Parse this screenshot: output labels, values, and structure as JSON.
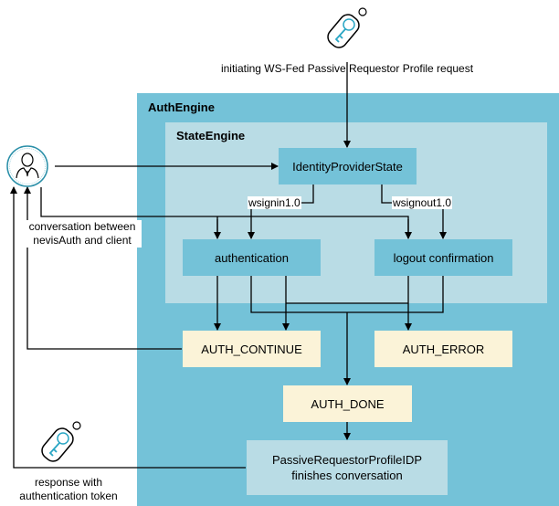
{
  "diagram": {
    "containers": {
      "auth_engine": "AuthEngine",
      "state_engine": "StateEngine"
    },
    "nodes": {
      "identity_provider_state": "IdentityProviderState",
      "authentication": "authentication",
      "logout_confirmation": "logout confirmation",
      "auth_continue": "AUTH_CONTINUE",
      "auth_error": "AUTH_ERROR",
      "auth_done": "AUTH_DONE",
      "passive_idp_line1": "PassiveRequestorProfileIDP",
      "passive_idp_line2": "finishes conversation"
    },
    "edge_labels": {
      "wsignin": "wsignin1.0",
      "wsignout": "wsignout1.0"
    },
    "annotations": {
      "request": "initiating WS-Fed Passive Requestor Profile request",
      "conversation_line1": "conversation between",
      "conversation_line2": "nevisAuth and client",
      "response_line1": "response with",
      "response_line2": "authentication token"
    },
    "icons": [
      "key-fob-icon",
      "user-icon",
      "key-fob-icon"
    ],
    "colors": {
      "auth_engine": "#74c2d8",
      "state_engine": "#b9dce5",
      "state_box": "#74c2d8",
      "result_box": "#fbf3d8",
      "icon_accent": "#2aa6c4"
    }
  }
}
